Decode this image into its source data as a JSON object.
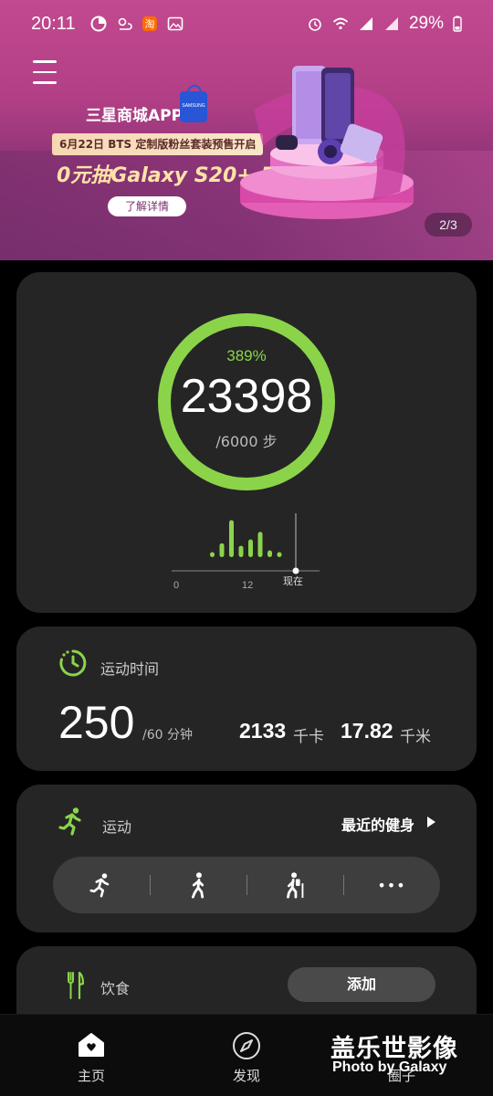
{
  "status_bar": {
    "time": "20:11",
    "network": "4G",
    "hd": "HD",
    "network2": "4G",
    "battery": "29%"
  },
  "banner": {
    "app_title": "三星商城APP",
    "bag_label": "SAMSUNG",
    "date_line": "6月22日 BTS 定制版粉丝套装预售开启",
    "main_line": "0元抽Galaxy S20+ 5G",
    "cta": "了解详情",
    "pager": "2/3"
  },
  "steps": {
    "percent": "389%",
    "count": "23398",
    "goal": "/6000 步",
    "progress_fraction": 1.0,
    "ring_color": "#8bd44a",
    "axis_start": "0",
    "axis_mid": "12",
    "axis_now": "现在"
  },
  "chart_data": {
    "type": "bar",
    "title": "",
    "xlabel": "",
    "ylabel": "",
    "x_ticks": [
      "0",
      "12",
      "现在"
    ],
    "values": [
      0.12,
      0.33,
      0.88,
      0.27,
      0.42,
      0.6,
      0.16,
      0.12
    ],
    "bar_color": "#8bd44a"
  },
  "active_time": {
    "title": "运动时间",
    "value": "250",
    "goal": "/60 分钟",
    "kcal_value": "2133",
    "kcal_unit": "千卡",
    "km_value": "17.82",
    "km_unit": "千米",
    "accent": "#8bd44a"
  },
  "exercise": {
    "title": "运动",
    "recent_link": "最近的健身",
    "buttons": [
      "running-icon",
      "walking-icon",
      "hiking-icon",
      "more-icon"
    ],
    "more_label": "•••"
  },
  "food": {
    "title": "饮食",
    "add_label": "添加"
  },
  "bottom_nav": {
    "home": "主页",
    "discover": "发现",
    "together": "圈子"
  },
  "watermark": {
    "cn": "盖乐世影像",
    "en": "Photo  by Galaxy"
  }
}
